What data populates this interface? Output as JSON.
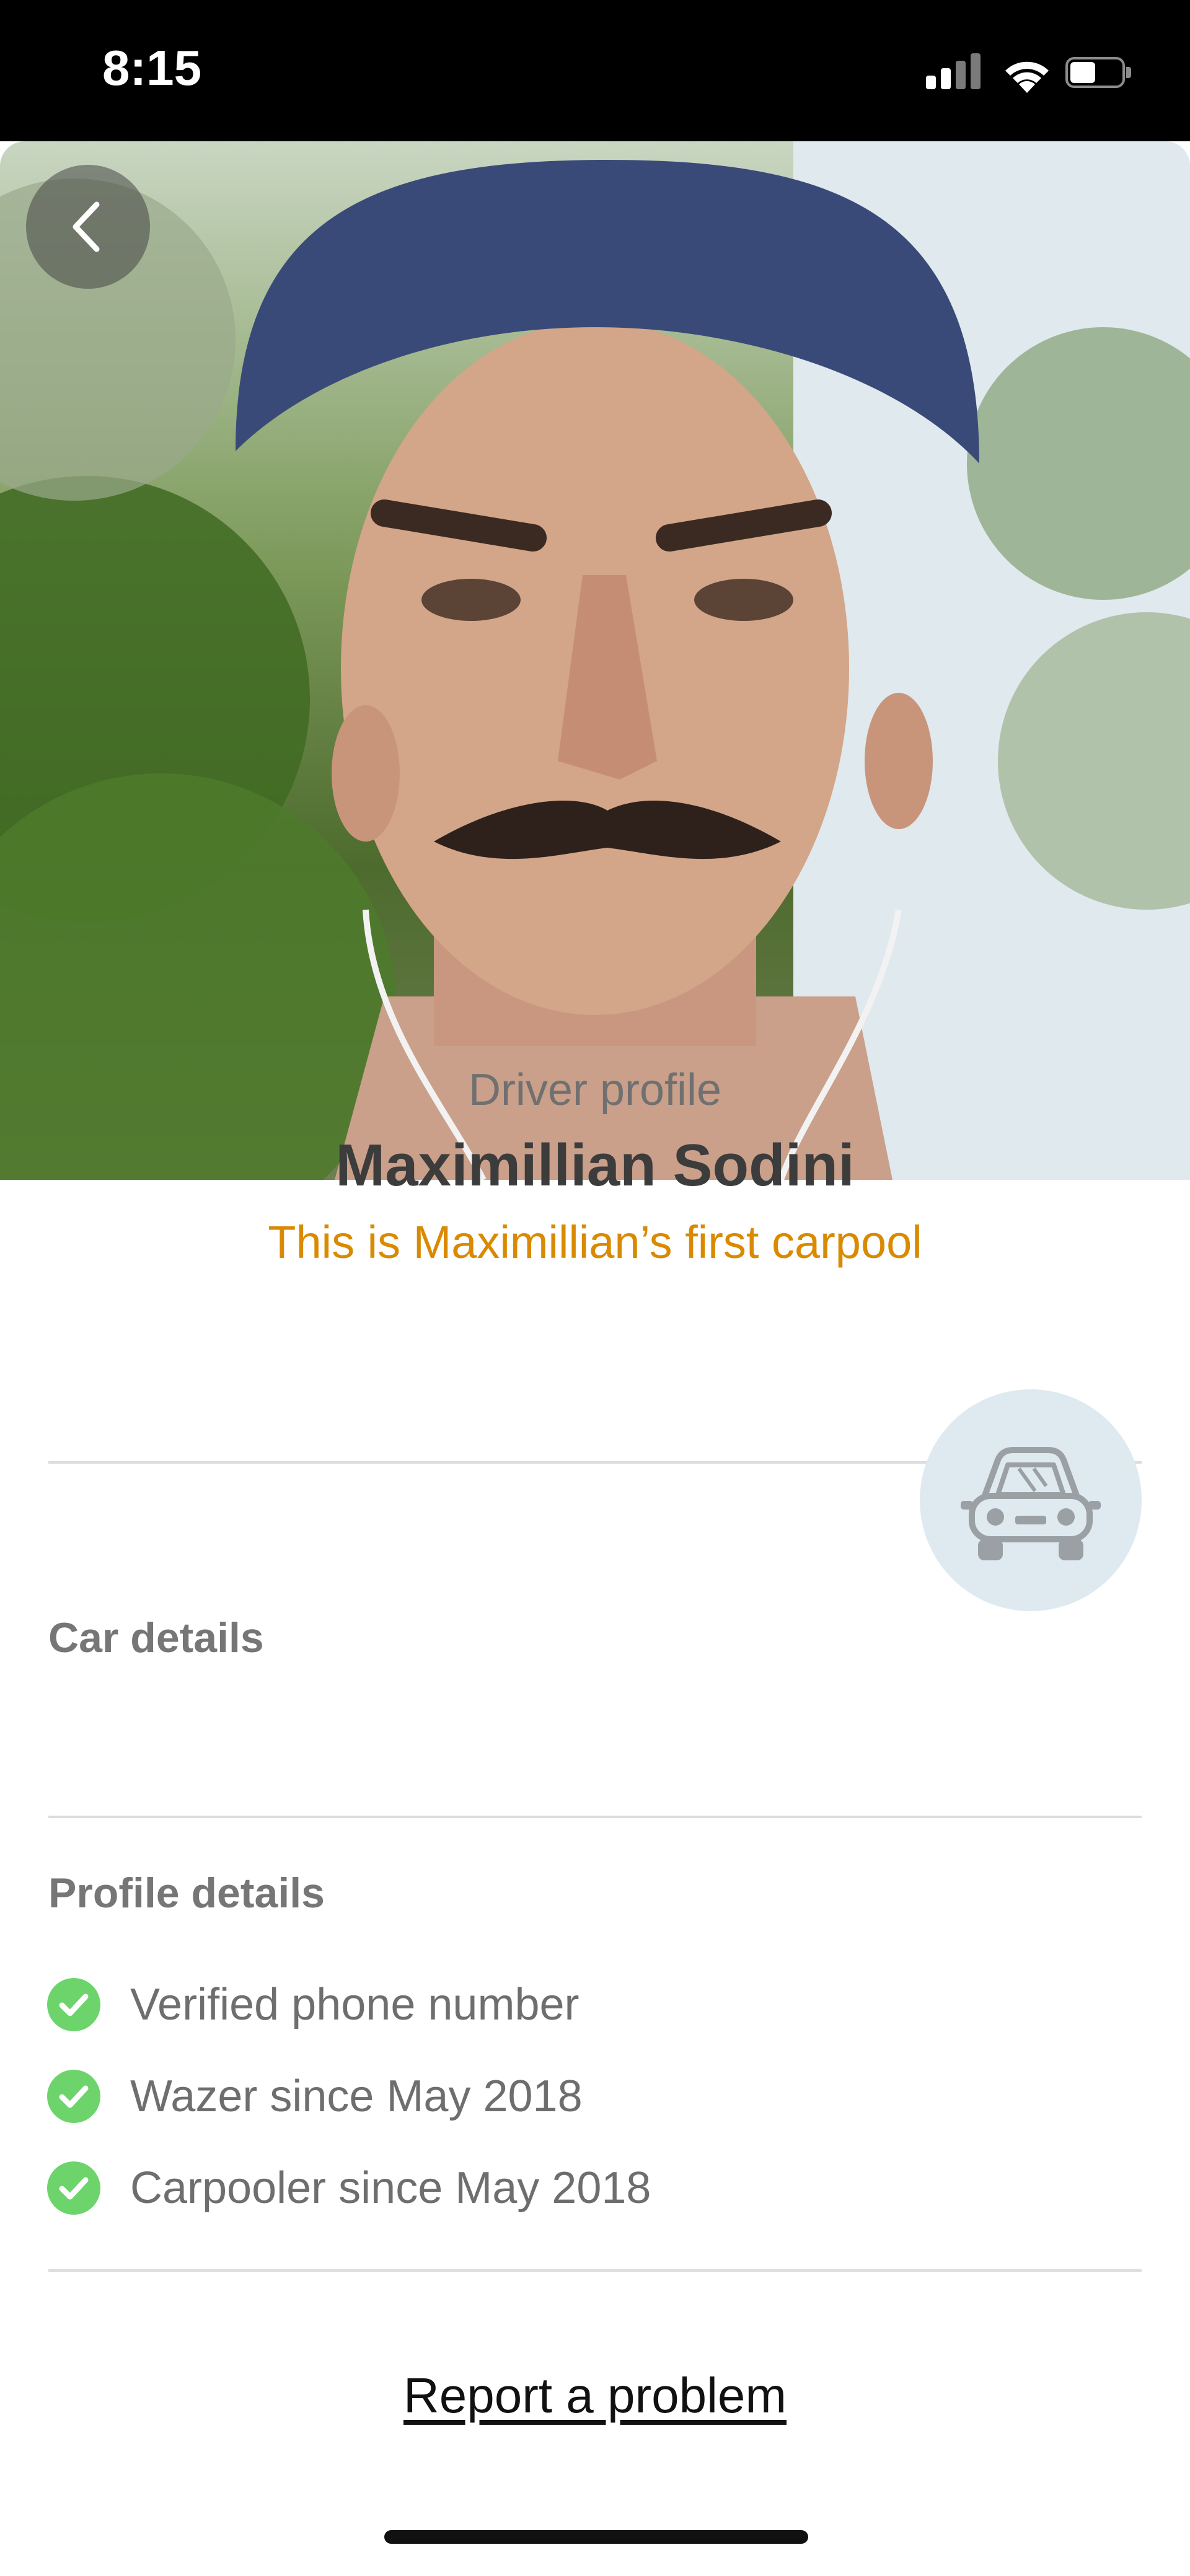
{
  "status_bar": {
    "time": "8:15"
  },
  "photo": {
    "alt": "driver photo"
  },
  "header": {
    "subtitle": "Driver profile",
    "name": "Maximillian Sodini",
    "first_carpool": "This is Maximillian’s first carpool"
  },
  "car": {
    "label": "Car details"
  },
  "profile": {
    "label": "Profile details",
    "items": [
      {
        "text": "Verified phone number"
      },
      {
        "text": "Wazer since May 2018"
      },
      {
        "text": "Carpooler since May 2018"
      }
    ]
  },
  "footer": {
    "report_link": "Report a problem"
  },
  "colors": {
    "accent_orange": "#d98a00",
    "check_green": "#6cd46b",
    "car_circle": "#dfeaf0"
  }
}
